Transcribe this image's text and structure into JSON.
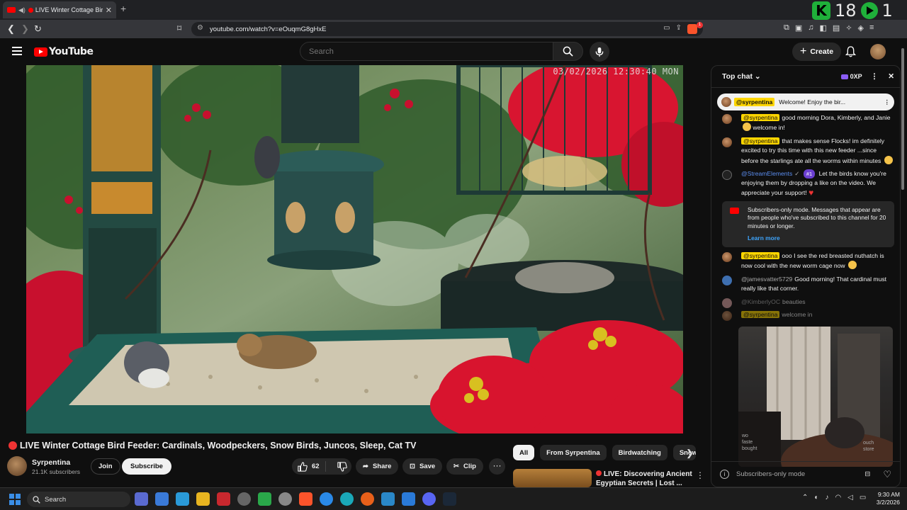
{
  "browser": {
    "tab_title": "LIVE Winter Cottage Bird F",
    "new_tab": "+",
    "url": "youtube.com/watch?v=eOuqmG8gHxE",
    "overlay_count": "18",
    "overlay_right": "1",
    "extension_badge": "1"
  },
  "youtube": {
    "logo_text": "YouTube",
    "search_placeholder": "Search",
    "create_label": "Create"
  },
  "video": {
    "timestamp": "03/02/2026 12:30:40 MON",
    "title": "LIVE Winter Cottage Bird Feeder: Cardinals, Woodpeckers, Snow Birds, Juncos, Sleep, Cat TV",
    "channel_name": "Syrpentina",
    "subscribers": "21.1K subscribers",
    "join_label": "Join",
    "subscribe_label": "Subscribe",
    "like_count": "62",
    "share_label": "Share",
    "save_label": "Save",
    "clip_label": "Clip",
    "more_label": "···"
  },
  "related": {
    "chips": [
      "All",
      "From Syrpentina",
      "Birdwatching",
      "Snow"
    ],
    "next_title_line1": "LIVE: Discovering Ancient",
    "next_title_line2": "Egyptian Secrets | Lost ..."
  },
  "chat": {
    "mode_label": "Top chat",
    "points_label": "0XP",
    "pinned_user": "@syrpentina",
    "pinned_text": "Welcome! Enjoy the bir...",
    "messages": [
      {
        "user": "@syrpentina",
        "text": "good morning Dora, Kimberly, and Janie",
        "suffix": "welcome in!"
      },
      {
        "user": "@syrpentina",
        "text": "that makes sense Flocks! im definitely excited to try this time with this new feeder ...since before the starlings ate all the worms within minutes"
      },
      {
        "user": "@StreamElements",
        "badge": "#1",
        "text": "Let the birds know you're enjoying them by dropping a like on the video. We appreciate your support!"
      },
      {
        "user": "@syrpentina",
        "text": "ooo I see the red breasted nuthatch is now cool with the new worm cage now"
      },
      {
        "user": "@jamesvatter5729",
        "text": "Good morning! That cardinal must really like that corner."
      },
      {
        "user": "@KimberlyOC",
        "text": "beauties"
      },
      {
        "user": "@syrpentina",
        "text": "welcome in"
      }
    ],
    "subscribers_notice": "Subscribers-only mode. Messages that appear are from people who've subscribed to this channel for 20 minutes or longer.",
    "learn_more": "Learn more",
    "footer_text": "Subscribers-only mode",
    "partial_1": "wo",
    "partial_2": "faste",
    "partial_3": "bought",
    "partial_4": "ouch",
    "partial_5": "store"
  },
  "taskbar": {
    "search_label": "Search",
    "time": "9:30 AM",
    "date": "3/2/2026"
  },
  "colors": {
    "accent_red": "#ff0000",
    "chat_highlight": "#ffd600",
    "link_blue": "#3ea6ff",
    "overlay_green": "#1fb03a"
  }
}
